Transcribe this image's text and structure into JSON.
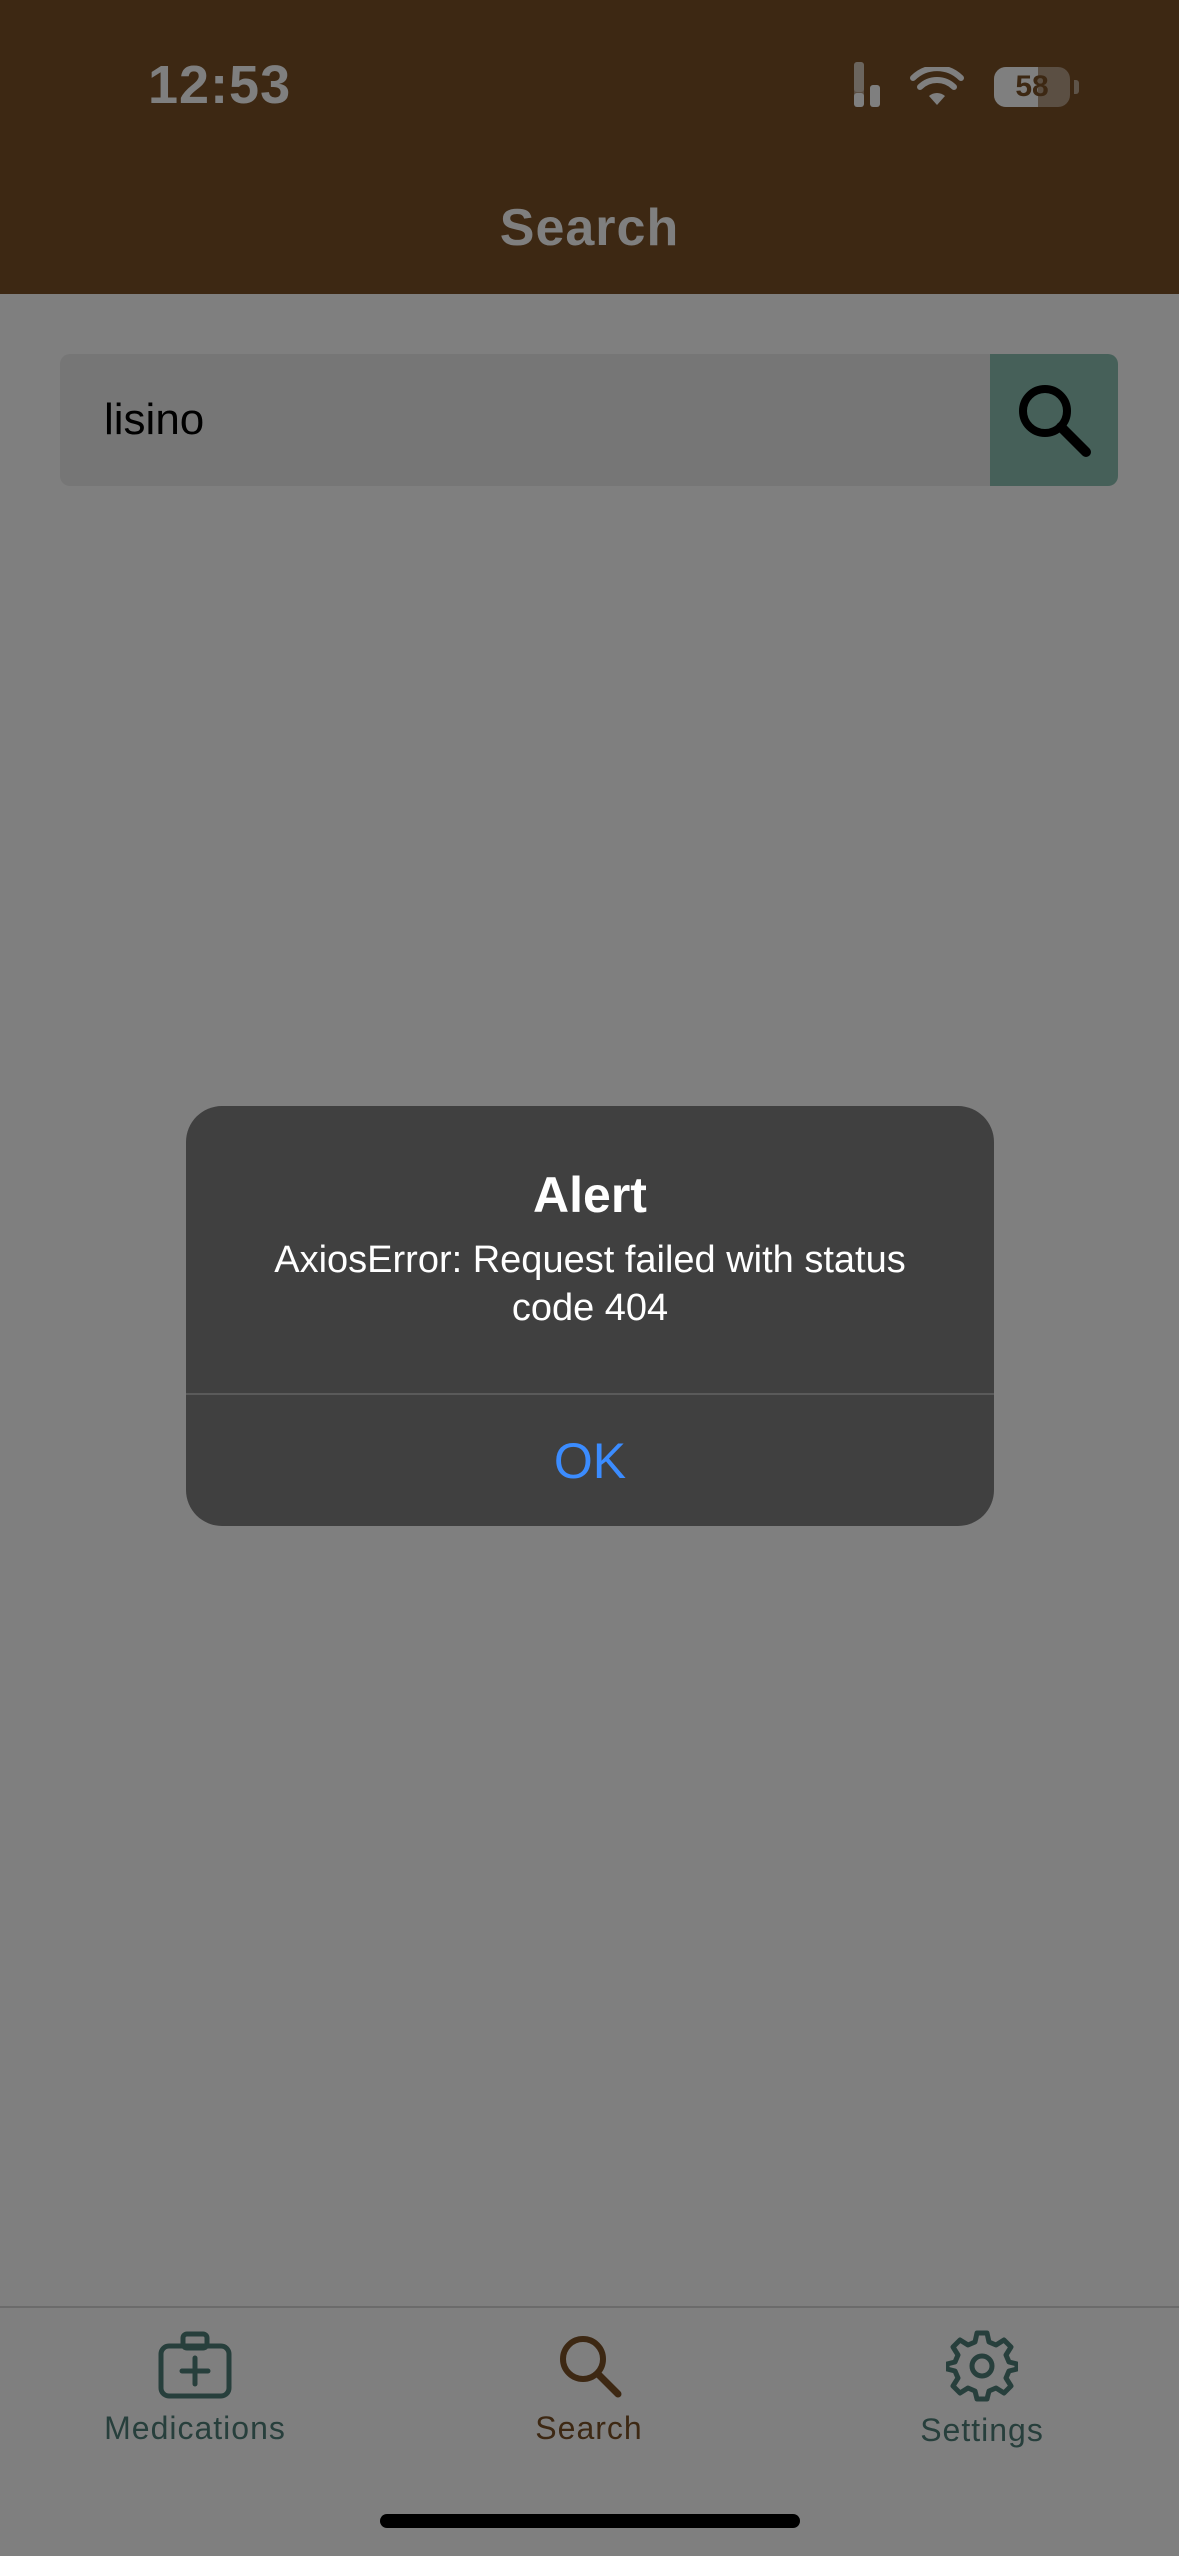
{
  "status_bar": {
    "time": "12:53",
    "battery_level": "58",
    "battery_fraction": 0.58,
    "signal_bars_active": 2,
    "signal_bars_total": 4
  },
  "header": {
    "title": "Search",
    "background_color": "#7b5026"
  },
  "search": {
    "value": "lisino",
    "button_icon": "search-icon",
    "button_color": "#8cc1b3"
  },
  "alert": {
    "title": "Alert",
    "message": "AxiosError: Request failed with status code 404",
    "ok_label": "OK"
  },
  "tabbar": {
    "active_tab": "search",
    "active_color": "#7b5026",
    "inactive_color": "#4f7f78",
    "items": [
      {
        "id": "medications",
        "label": "Medications",
        "icon": "medical-kit-icon"
      },
      {
        "id": "search",
        "label": "Search",
        "icon": "search-icon"
      },
      {
        "id": "settings",
        "label": "Settings",
        "icon": "gear-icon"
      }
    ]
  }
}
